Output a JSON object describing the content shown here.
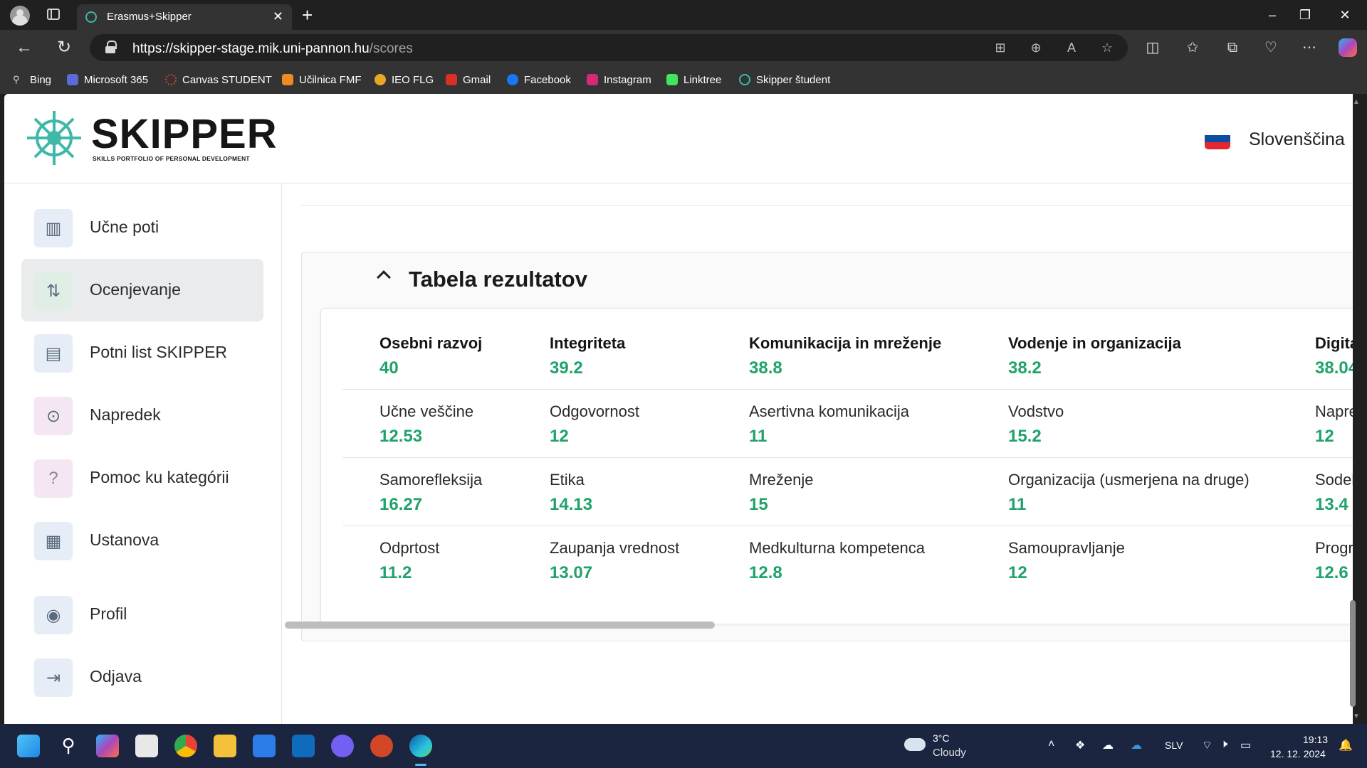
{
  "browser": {
    "tab_title": "Erasmus+Skipper",
    "url_host": "https://skipper-stage.mik.uni-pannon.hu",
    "url_path": "/scores",
    "bookmarks": [
      {
        "label": "Bing",
        "color": "#8a8a8a"
      },
      {
        "label": "Microsoft 365",
        "color": "#5b6bd5"
      },
      {
        "label": "Canvas STUDENT",
        "color": "#e03a2f"
      },
      {
        "label": "Učilnica FMF",
        "color": "#f08a24"
      },
      {
        "label": "IEO FLG",
        "color": "#e7a82a"
      },
      {
        "label": "Gmail",
        "color": "#d93025"
      },
      {
        "label": "Facebook",
        "color": "#1877f2"
      },
      {
        "label": "Instagram",
        "color": "#d62976"
      },
      {
        "label": "Linktree",
        "color": "#43e55e"
      },
      {
        "label": "Skipper študent",
        "color": "#3fb8a7"
      }
    ]
  },
  "header": {
    "logo_text": "SKIPPER",
    "logo_subtitle": "SKILLS PORTFOLIO OF PERSONAL DEVELOPMENT",
    "language": "Slovenščina"
  },
  "sidebar": {
    "items": [
      {
        "label": "Učne poti",
        "icon": "books-icon",
        "tint": "#e6edf7"
      },
      {
        "label": "Ocenjevanje",
        "icon": "git-compare-icon",
        "tint": "#e1eee6"
      },
      {
        "label": "Potni list SKIPPER",
        "icon": "certificate-icon",
        "tint": "#e6edf7"
      },
      {
        "label": "Napredek",
        "icon": "progress-icon",
        "tint": "#f4e6f3"
      },
      {
        "label": "Pomoc ku kategórii",
        "icon": "question-icon",
        "tint": "#f4e6f3"
      },
      {
        "label": "Ustanova",
        "icon": "building-icon",
        "tint": "#e6edf7"
      },
      {
        "label": "Profil",
        "icon": "user-circle-icon",
        "tint": "#e6edf7"
      },
      {
        "label": "Odjava",
        "icon": "logout-icon",
        "tint": "#e6edf7"
      }
    ]
  },
  "results": {
    "title": "Tabela rezultatov",
    "rows": [
      [
        {
          "label": "Osebni razvoj",
          "value": "40"
        },
        {
          "label": "Integriteta",
          "value": "39.2"
        },
        {
          "label": "Komunikacija in mreženje",
          "value": "38.8"
        },
        {
          "label": "Vodenje in organizacija",
          "value": "38.2"
        },
        {
          "label": "Digita",
          "value": "38.04"
        }
      ],
      [
        {
          "label": "Učne veščine",
          "value": "12.53"
        },
        {
          "label": "Odgovornost",
          "value": "12"
        },
        {
          "label": "Asertivna komunikacija",
          "value": "11"
        },
        {
          "label": "Vodstvo",
          "value": "15.2"
        },
        {
          "label": "Napre",
          "value": "12"
        }
      ],
      [
        {
          "label": "Samorefleksija",
          "value": "16.27"
        },
        {
          "label": "Etika",
          "value": "14.13"
        },
        {
          "label": "Mreženje",
          "value": "15"
        },
        {
          "label": "Organizacija (usmerjena na druge)",
          "value": "11"
        },
        {
          "label": "Sodel",
          "value": "13.4"
        }
      ],
      [
        {
          "label": "Odprtost",
          "value": "11.2"
        },
        {
          "label": "Zaupanja vrednost",
          "value": "13.07"
        },
        {
          "label": "Medkulturna kompetenca",
          "value": "12.8"
        },
        {
          "label": "Samoupravljanje",
          "value": "12"
        },
        {
          "label": "Progr",
          "value": "12.6"
        }
      ]
    ]
  },
  "taskbar": {
    "weather_temp": "3°C",
    "weather_cond": "Cloudy",
    "lang": "SLV",
    "time": "19:13",
    "date": "12. 12. 2024"
  },
  "colors": {
    "score_green": "#1fa36a",
    "brand_teal": "#3fb8a7"
  }
}
